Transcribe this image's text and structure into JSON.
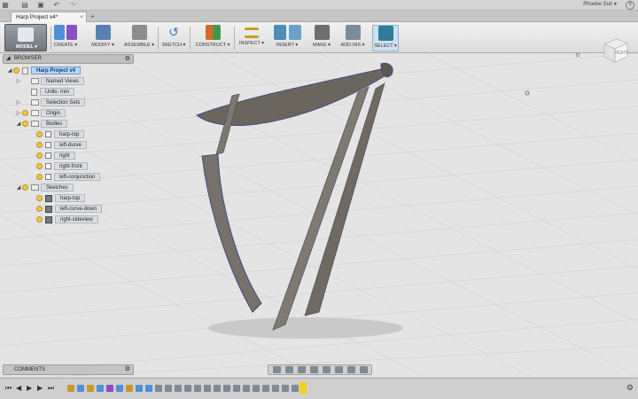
{
  "window": {
    "tab_title": "Harp Project v4*",
    "tab_close": "×",
    "add_tab": "+",
    "user_name": "Phoebe Sun ▾",
    "help": "?"
  },
  "ribbon": {
    "workspace": "MODEL ▾",
    "groups": [
      {
        "label": "CREATE ▾",
        "color": "#4f90d6"
      },
      {
        "label": "MODIFY ▾",
        "color": "#5a7fb3"
      },
      {
        "label": "ASSEMBLE ▾",
        "color": "#8c8c8c"
      },
      {
        "label": "SKETCH ▾",
        "color": "#3c7ac4"
      },
      {
        "label": "CONSTRUCT ▾",
        "color": "#d06a2e"
      },
      {
        "label": "INSPECT ▾",
        "color": "#c59a2b"
      },
      {
        "label": "INSERT ▾",
        "color": "#4f8bb7"
      },
      {
        "label": "MAKE ▾",
        "color": "#6d6d6d"
      },
      {
        "label": "ADD-INS ▾",
        "color": "#7e8a96"
      },
      {
        "label": "SELECT ▾",
        "color": "#2f7d9a"
      }
    ]
  },
  "browser": {
    "title": "BROWSER",
    "root": "Harp Project v4",
    "items": [
      {
        "label": "Named Views",
        "level": 1,
        "arrow": "▷",
        "bulb": false,
        "icon": "folder"
      },
      {
        "label": "Units: mm",
        "level": 1,
        "arrow": "",
        "bulb": false,
        "icon": "doc"
      },
      {
        "label": "Selection Sets",
        "level": 1,
        "arrow": "▷",
        "bulb": false,
        "icon": "folder"
      },
      {
        "label": "Origin",
        "level": 1,
        "arrow": "▷",
        "bulb": true,
        "icon": "folder"
      },
      {
        "label": "Bodies",
        "level": 1,
        "arrow": "◢",
        "bulb": true,
        "icon": "folder"
      },
      {
        "label": "harp-top",
        "level": 2,
        "arrow": "",
        "bulb": true,
        "icon": "body"
      },
      {
        "label": "left-durve",
        "level": 2,
        "arrow": "",
        "bulb": true,
        "icon": "body"
      },
      {
        "label": "right",
        "level": 2,
        "arrow": "",
        "bulb": true,
        "icon": "body"
      },
      {
        "label": "right-front",
        "level": 2,
        "arrow": "",
        "bulb": true,
        "icon": "body"
      },
      {
        "label": "left-conjunction",
        "level": 2,
        "arrow": "",
        "bulb": true,
        "icon": "body"
      },
      {
        "label": "Sketches",
        "level": 1,
        "arrow": "◢",
        "bulb": true,
        "icon": "folder"
      },
      {
        "label": "harp-top",
        "level": 2,
        "arrow": "",
        "bulb": true,
        "icon": "sketch"
      },
      {
        "label": "left-curve-down",
        "level": 2,
        "arrow": "",
        "bulb": true,
        "icon": "sketch"
      },
      {
        "label": "right-sideview",
        "level": 2,
        "arrow": "",
        "bulb": true,
        "icon": "sketch"
      }
    ]
  },
  "viewcube": {
    "face": "RIGHT"
  },
  "comments": {
    "title": "COMMENTS"
  },
  "colors": {
    "body_fill": "#6b665d",
    "body_edge": "#4a4a8a",
    "highlight": "#f2d21b"
  }
}
